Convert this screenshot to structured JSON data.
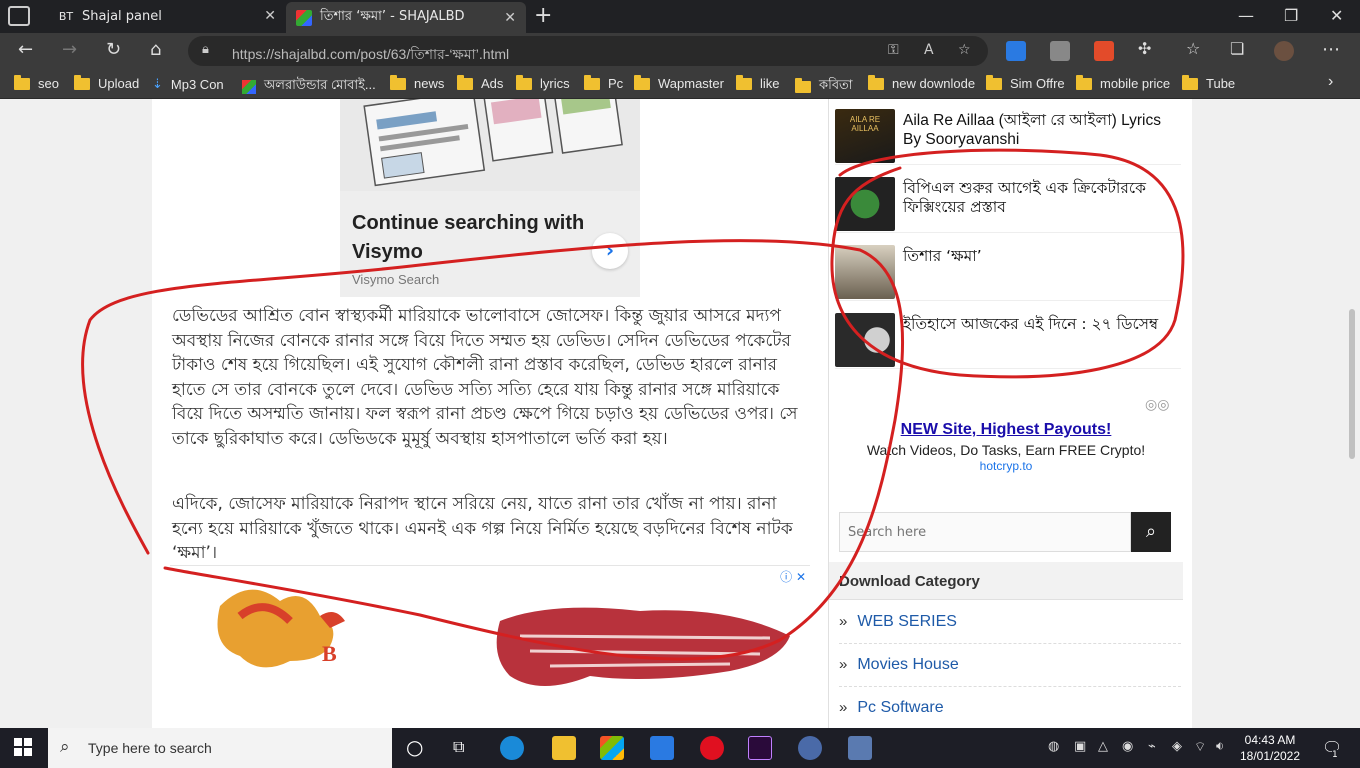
{
  "browser": {
    "tabs": [
      {
        "favicon": "BT",
        "title": "Shajal panel"
      },
      {
        "favicon": "site-logo",
        "title": "তিশার ‘ক্ষমা’ - SHAJALBD"
      }
    ],
    "url": "https://shajalbd.com/post/63/তিশার-‘ক্ষমা’.html",
    "bookmarks": [
      "seo",
      "Upload",
      "Mp3 Con",
      "অলরাউন্ডার মোবাই...",
      "news",
      "Ads",
      "lyrics",
      "Pc",
      "Wapmaster",
      "like",
      "কবিতা",
      "new downlode",
      "Sim Offre",
      "mobile price",
      "Tube"
    ]
  },
  "ad_card": {
    "title": "Continue searching with Visymo",
    "source": "Visymo Search"
  },
  "article": {
    "para1": "ডেভিডের আশ্রিত বোন স্বাস্থ্যকর্মী মারিয়াকে ভালোবাসে জোসেফ। কিন্তু জুয়ার আসরে মদ্যপ অবস্থায় নিজের বোনকে রানার সঙ্গে বিয়ে দিতে সম্মত হয় ডেভিড। সেদিন ডেভিডের পকেটের টাকাও শেষ হয়ে গিয়েছিল। এই সুযোগ কৌশলী রানা প্রস্তাব করেছিল, ডেভিড হারলে রানার হাতে সে তার বোনকে তুলে দেবে। ডেভিড সত্যি সত্যি হেরে যায় কিন্তু রানার সঙ্গে মারিয়াকে বিয়ে দিতে অসম্মতি জানায়। ফল স্বরূপ রানা প্রচণ্ড ক্ষেপে গিয়ে চড়াও হয় ডেভিডের ওপর। সে তাকে ছুরিকাঘাত করে। ডেভিডকে মুমূর্ষু অবস্থায় হাসপাতালে ভর্তি করা হয়।",
    "para2": "এদিকে, জোসেফ মারিয়াকে নিরাপদ স্থানে সরিয়ে নেয়, যাতে রানা তার খোঁজ না পায়। রানা হন্যে হয়ে মারিয়াকে খুঁজতে থাকে। এমনই এক গল্প নিয়ে নির্মিত হয়েছে বড়দিনের বিশেষ নাটক ‘ক্ষমা’।"
  },
  "sidebar": {
    "posts": [
      {
        "title": "Aila Re Aillaa (আইলা রে আইলা) Lyrics By Sooryavanshi"
      },
      {
        "title": "বিপিএল শুরুর আগেই এক ক্রিকেটারকে ফিক্সিংয়ের প্রস্তাব"
      },
      {
        "title": "তিশার ‘ক্ষমা’"
      },
      {
        "title": "ইতিহাসে আজকের এই দিনে : ২৭ ডিসেম্ব"
      }
    ],
    "ad": {
      "title": "NEW Site, Highest Payouts!",
      "desc": "Watch Videos, Do Tasks, Earn FREE Crypto!",
      "url": "hotcryp.to"
    },
    "search_placeholder": "Search here",
    "category_heading": "Download Category",
    "categories": [
      "WEB SERIES",
      "Movies House",
      "Pc Software"
    ]
  },
  "taskbar": {
    "search_placeholder": "Type here to search",
    "time": "04:43 AM",
    "date": "18/01/2022",
    "notifications": "1"
  },
  "colors": {
    "annotation": "#d42020",
    "link": "#1e5aa8"
  }
}
